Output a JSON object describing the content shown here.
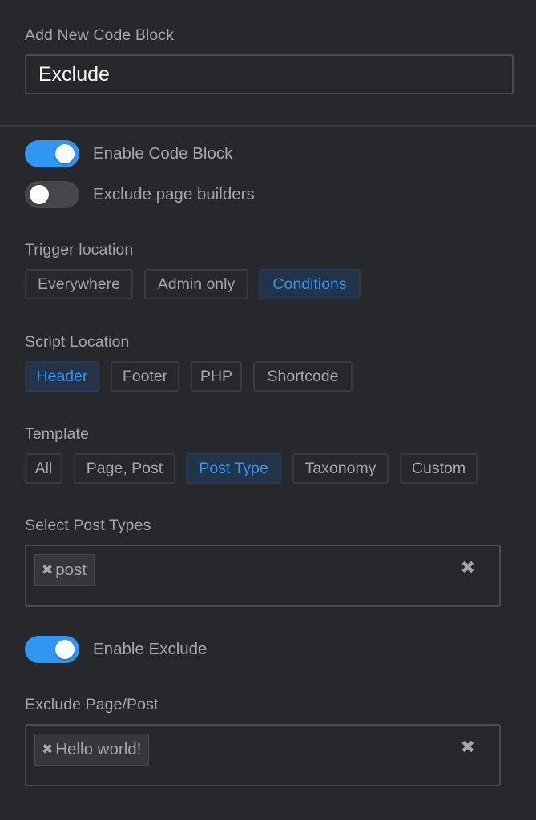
{
  "header": {
    "label": "Add New Code Block",
    "title_value": "Exclude",
    "title_placeholder": ""
  },
  "toggles": {
    "enable_code_block": {
      "label": "Enable Code Block",
      "on": true
    },
    "exclude_page_builders": {
      "label": "Exclude page builders",
      "on": false
    },
    "enable_exclude": {
      "label": "Enable Exclude",
      "on": true
    }
  },
  "trigger_location": {
    "label": "Trigger location",
    "options": [
      "Everywhere",
      "Admin only",
      "Conditions"
    ],
    "selected": "Conditions"
  },
  "script_location": {
    "label": "Script Location",
    "options": [
      "Header",
      "Footer",
      "PHP",
      "Shortcode"
    ],
    "selected": "Header"
  },
  "template": {
    "label": "Template",
    "options": [
      "All",
      "Page, Post",
      "Post Type",
      "Taxonomy",
      "Custom"
    ],
    "selected": "Post Type"
  },
  "post_types": {
    "label": "Select Post Types",
    "tags": [
      "post"
    ],
    "remove_glyph": "✖",
    "clear_glyph": "✖"
  },
  "exclude": {
    "label": "Exclude Page/Post",
    "tags": [
      "Hello world!"
    ],
    "remove_glyph": "✖",
    "clear_glyph": "✖"
  },
  "colors": {
    "background": "#27282c",
    "accent": "#2d97f3",
    "active_bg": "#233348",
    "text": "#a5a6a9"
  }
}
